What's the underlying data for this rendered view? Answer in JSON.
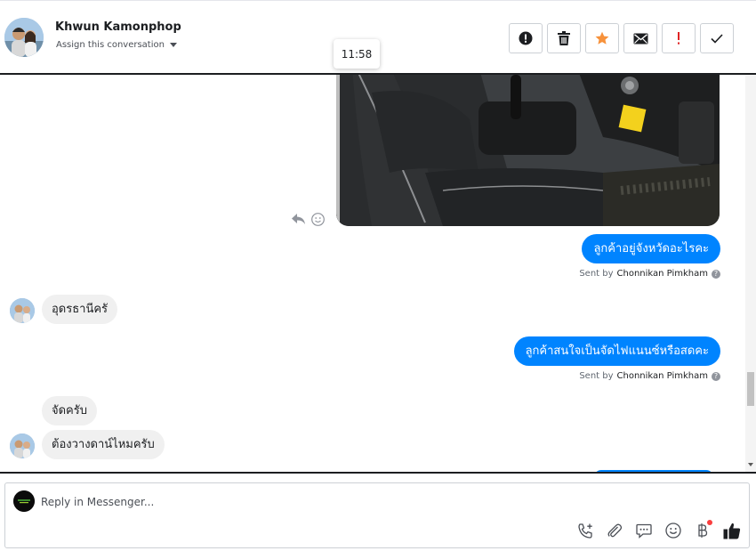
{
  "header": {
    "contact_name": "Khwun Kamonphop",
    "assign_label": "Assign this conversation",
    "timestamp_tooltip": "11:58",
    "actions": [
      {
        "name": "mark-spam-button",
        "icon": "exclamation-circle-icon"
      },
      {
        "name": "delete-button",
        "icon": "trash-icon"
      },
      {
        "name": "star-button",
        "icon": "star-icon",
        "color": "#f7923b"
      },
      {
        "name": "mark-unread-button",
        "icon": "envelope-icon"
      },
      {
        "name": "follow-up-button",
        "icon": "exclamation-icon",
        "color": "#e02424"
      },
      {
        "name": "mark-done-button",
        "icon": "checkmark-icon"
      }
    ]
  },
  "messages": {
    "out1": "ลูกค้าอยู่จังหวัดอะไรคะ",
    "sent_by_prefix": "Sent by",
    "sender": "Chonnikan Pimkham",
    "in1": "อุดรธานีครั",
    "out2": "ลูกค้าสนใจเป็นจัดไฟแนนซ์หรือสดคะ",
    "in2": "จัดครับ",
    "in3": "ต้องวางดาน์ไหมครับ"
  },
  "composer": {
    "placeholder": "Reply in Messenger...",
    "tools": [
      "call-icon",
      "paperclip-icon",
      "saved-reply-icon",
      "emoji-icon",
      "baht-payment-icon",
      "thumbs-up-icon"
    ]
  },
  "colors": {
    "outgoing_bubble": "#0084ff",
    "incoming_bubble": "#f0f0f0",
    "star": "#f7923b",
    "alert": "#e02424"
  }
}
